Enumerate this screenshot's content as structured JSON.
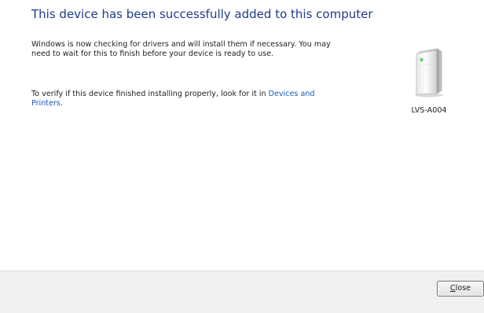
{
  "dialog": {
    "heading": "This device has been successfully added to this computer",
    "paragraph1": "Windows is now checking for drivers and will install them if necessary. You may need to wait for this to finish before your device is ready to use.",
    "paragraph2_text": "To verify if this device finished installing properly, look for it in ",
    "paragraph2_link": "Devices and Printers",
    "paragraph2_end": "."
  },
  "device": {
    "icon": "external-storage-device-icon",
    "label": "LVS-A004"
  },
  "footer": {
    "close_accel": "C",
    "close_rest": "lose"
  },
  "colors": {
    "heading": "#1d3c8a",
    "link": "#1a5ab4",
    "footer_bg": "#f0f0f0"
  }
}
